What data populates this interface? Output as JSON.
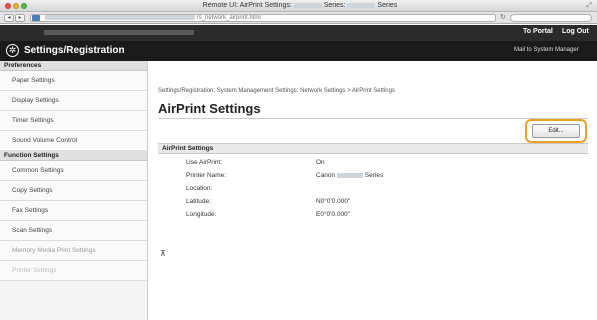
{
  "window": {
    "title": "Remote UI: AirPrint Settings:",
    "title_series_1": "Series:",
    "title_series_2": "Series",
    "url_suffix": "rs_network_airprint.html"
  },
  "header": {
    "to_portal": "To Portal",
    "logout": "Log Out",
    "app_title": "Settings/Registration",
    "mail_admin": "Mail to System Manager"
  },
  "sidebar": {
    "sections": [
      {
        "heading": "Preferences",
        "items": [
          "Paper Settings",
          "Display Settings",
          "Timer Settings",
          "Sound Volume Control"
        ]
      },
      {
        "heading": "Function Settings",
        "items": [
          "Common Settings",
          "Copy Settings",
          "Fax Settings",
          "Scan Settings",
          "Memory Media Print Settings",
          "Printer Settings"
        ]
      }
    ]
  },
  "main": {
    "breadcrumb": "Settings/Registration: System Management Settings: Network Settings > AirPrint Settings",
    "page_title": "AirPrint Settings",
    "edit_label": "Edit...",
    "section_title": "AirPrint Settings",
    "rows": [
      {
        "label": "Use AirPrint:",
        "value": "On"
      },
      {
        "label": "Printer Name:",
        "value_prefix": "Canon",
        "value_suffix": "Series"
      },
      {
        "label": "Location:",
        "value": ""
      },
      {
        "label": "Latitude:",
        "value": "N0°0'0.000\""
      },
      {
        "label": "Longitude:",
        "value": "E0°0'0.000\""
      }
    ],
    "back_to_top_icon": "⊼"
  },
  "colors": {
    "header_dark": "#1a1a1a",
    "highlight": "#f0a023"
  }
}
